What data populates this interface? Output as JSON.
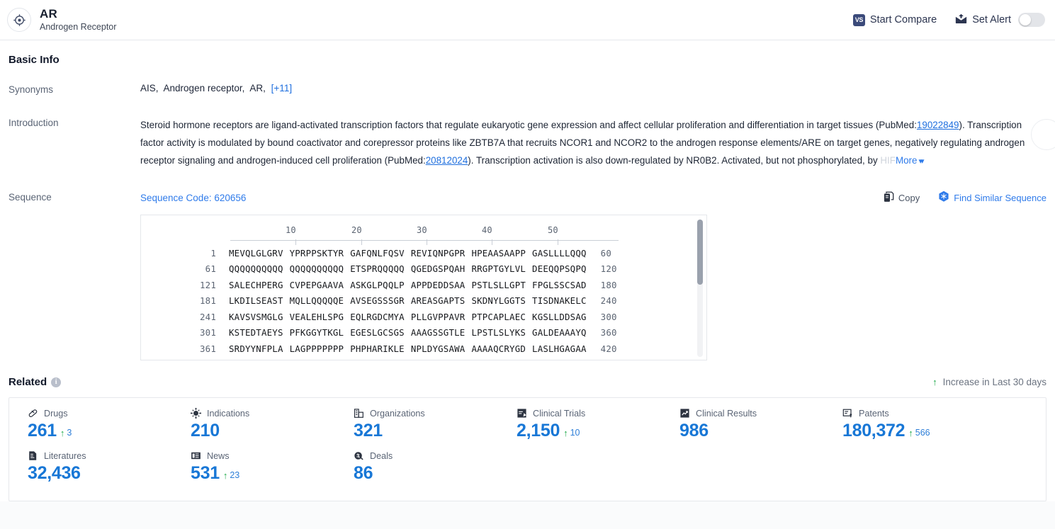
{
  "header": {
    "logo_icon": "target-crosshair-icon",
    "title": "AR",
    "subtitle": "Androgen Receptor",
    "compare_label": "Start Compare",
    "compare_badge": "VS",
    "alert_label": "Set Alert",
    "alert_enabled": false
  },
  "basic_info": {
    "heading": "Basic Info",
    "synonyms_label": "Synonyms",
    "synonyms": [
      "AIS,",
      "Androgen receptor,",
      "AR,"
    ],
    "synonyms_more": "[+11]",
    "introduction_label": "Introduction",
    "introduction_line1_a": "Steroid hormone receptors are ligand-activated transcription factors that regulate eukaryotic gene expression and affect cellular proliferation and differentiation in target tissues (PubMed:",
    "introduction_pmid1": "19022849",
    "introduction_line1_b": ").",
    "introduction_line2": "Transcription factor activity is modulated by bound coactivator and corepressor proteins like ZBTB7A that recruits NCOR1 and NCOR2 to the androgen response elements/ARE on target genes, negatively",
    "introduction_line3_a": "regulating androgen receptor signaling and androgen-induced cell proliferation (PubMed:",
    "introduction_pmid2": "20812024",
    "introduction_line3_b": "). Transcription activation is also down-regulated by NR0B2. Activated, but not phosphorylated, by ",
    "introduction_faded": "HIF",
    "more_label": "More"
  },
  "sequence": {
    "row_label": "Sequence",
    "code_label": "Sequence Code: 620656",
    "copy_label": "Copy",
    "find_similar_label": "Find Similar Sequence",
    "ruler": [
      "10",
      "20",
      "30",
      "40",
      "50"
    ],
    "lines": [
      {
        "start": "1",
        "chunks": [
          "MEVQLGLGRV",
          "YPRPPSKTYR",
          "GAFQNLFQSV",
          "REVIQNPGPR",
          "HPEAASAAPP",
          "GASLLLLQQQ"
        ],
        "end": "60"
      },
      {
        "start": "61",
        "chunks": [
          "QQQQQQQQQQ",
          "QQQQQQQQQQ",
          "ETSPRQQQQQ",
          "QGEDGSPQAH",
          "RRGPTGYLVL",
          "DEEQQPSQPQ"
        ],
        "end": "120"
      },
      {
        "start": "121",
        "chunks": [
          "SALECHPERG",
          "CVPEPGAAVA",
          "ASKGLPQQLP",
          "APPDEDDSAA",
          "PSTLSLLGPT",
          "FPGLSSCSAD"
        ],
        "end": "180"
      },
      {
        "start": "181",
        "chunks": [
          "LKDILSEAST",
          "MQLLQQQQQE",
          "AVSEGSSSGR",
          "AREASGAPTS",
          "SKDNYLGGTS",
          "TISDNAKELC"
        ],
        "end": "240"
      },
      {
        "start": "241",
        "chunks": [
          "KAVSVSMGLG",
          "VEALEHLSPG",
          "EQLRGDCMYA",
          "PLLGVPPAVR",
          "PTPCAPLAEC",
          "KGSLLDDSAG"
        ],
        "end": "300"
      },
      {
        "start": "301",
        "chunks": [
          "KSTEDTAEYS",
          "PFKGGYTKGL",
          "EGESLGCSGS",
          "AAAGSSGTLE",
          "LPSTLSLYKS",
          "GALDEAAAYQ"
        ],
        "end": "360"
      },
      {
        "start": "361",
        "chunks": [
          "SRDYYNFPLA",
          "LAGPPPPPPP",
          "PHPHARIKLE",
          "NPLDYGSAWA",
          "AAAAQCRYGD",
          "LASLHGAGAA"
        ],
        "end": "420"
      }
    ]
  },
  "related": {
    "heading": "Related",
    "info_icon": "info-icon",
    "increase_note": "Increase in Last 30 days",
    "increase_arrow_icon": "arrow-up-icon",
    "stats": [
      {
        "label": "Drugs",
        "icon": "pill-icon",
        "value": "261",
        "delta": "3"
      },
      {
        "label": "Indications",
        "icon": "virus-icon",
        "value": "210",
        "delta": ""
      },
      {
        "label": "Organizations",
        "icon": "organization-icon",
        "value": "321",
        "delta": ""
      },
      {
        "label": "Clinical Trials",
        "icon": "clinical-trial-icon",
        "value": "2,150",
        "delta": "10"
      },
      {
        "label": "Clinical Results",
        "icon": "clinical-result-icon",
        "value": "986",
        "delta": ""
      },
      {
        "label": "Patents",
        "icon": "patent-icon",
        "value": "180,372",
        "delta": "566"
      },
      {
        "label": "Literatures",
        "icon": "literature-icon",
        "value": "32,436",
        "delta": ""
      },
      {
        "label": "News",
        "icon": "news-icon",
        "value": "531",
        "delta": "23"
      },
      {
        "label": "Deals",
        "icon": "deal-icon",
        "value": "86",
        "delta": ""
      }
    ]
  },
  "colors": {
    "accent_blue": "#1877d6",
    "link_blue": "#2f7bea",
    "up_green": "#1faa4b",
    "dark_navy": "#3b4a7a"
  }
}
